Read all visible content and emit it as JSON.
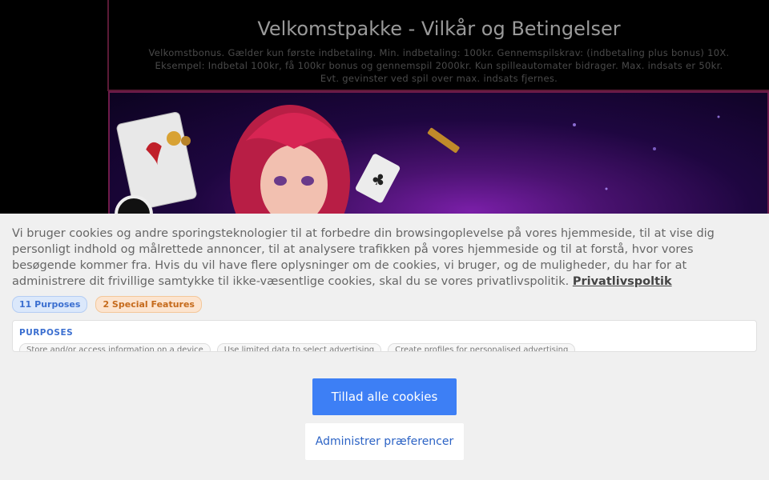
{
  "terms": {
    "title": "Velkomstpakke - Vilkår og Betingelser",
    "lines": [
      "Velkomstbonus. Gælder kun første indbetaling. Min. indbetaling: 100kr. Gennemspilskrav: (indbetaling plus bonus) 10X.",
      "Eksempel: Indbetal 100kr, få 100kr bonus og gennemspil 2000kr. Kun spilleautomater bidrager. Max. indsats er 50kr.",
      "Evt. gevinster ved spil over max. indsats fjernes."
    ]
  },
  "cookie": {
    "text": "Vi bruger cookies og andre sporingsteknologier til at forbedre din browsingoplevelse på vores hjemmeside, til at vise dig personligt indhold og målrettede annoncer, til at analysere trafikken på vores hjemmeside og til at forstå, hvor vores besøgende kommer fra. Hvis du vil have flere oplysninger om de cookies, vi bruger, og de muligheder, du har for at administrere dit frivillige samtykke til ikke-væsentlige cookies, skal du se vores privatlivspolitik.",
    "privacy_link": "Privatlivspoltik",
    "badges": {
      "purposes": "11 Purposes",
      "special": "2 Special Features"
    },
    "purposes_heading": "PURPOSES",
    "purpose_chips": [
      "Store and/or access information on a device",
      "Use limited data to select advertising",
      "Create profiles for personalised advertising"
    ],
    "accept_label": "Tillad alle cookies",
    "manage_label": "Administrer præferencer"
  },
  "colors": {
    "accent": "#3d7ff5",
    "hero_purple": "#7a1fa8",
    "hero_border": "#6e1b4a"
  }
}
